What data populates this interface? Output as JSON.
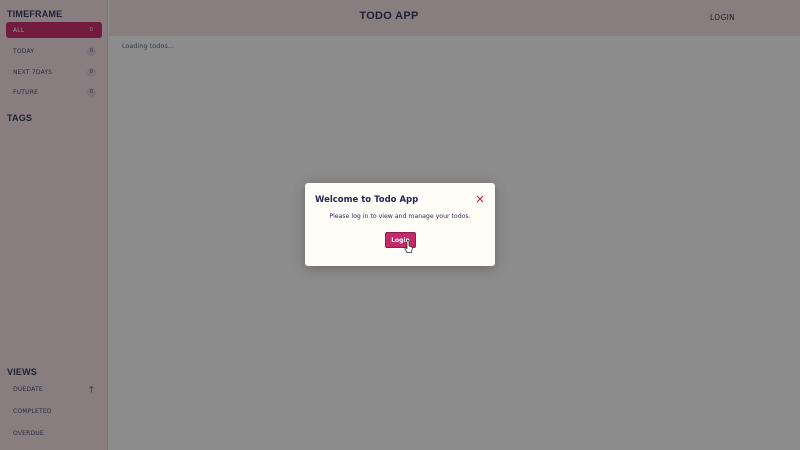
{
  "app": {
    "title": "TODO APP",
    "login_label": "LOGIN"
  },
  "sidebar": {
    "timeframe_title": "TIMEFRAME",
    "timeframe_items": [
      {
        "label": "ALL",
        "badge": "0",
        "active": true
      },
      {
        "label": "TODAY",
        "badge": "0"
      },
      {
        "label": "NEXT 7DAYS",
        "badge": "0"
      },
      {
        "label": "FUTURE",
        "badge": "0"
      }
    ],
    "tags_title": "TAGS",
    "views_title": "VIEWS",
    "views_items": [
      {
        "label": "DUEDATE",
        "icon": "arrow-up-icon"
      },
      {
        "label": "COMPLETED"
      },
      {
        "label": "OVERDUE"
      }
    ]
  },
  "main": {
    "loading_text": "Loading todos..."
  },
  "modal": {
    "title": "Welcome to Todo App",
    "message": "Please log in to view and manage your todos.",
    "login_button": "Login"
  },
  "colors": {
    "accent": "#c0255f",
    "sidebar_bg": "#ead7d8",
    "text": "#2b2d4f"
  }
}
